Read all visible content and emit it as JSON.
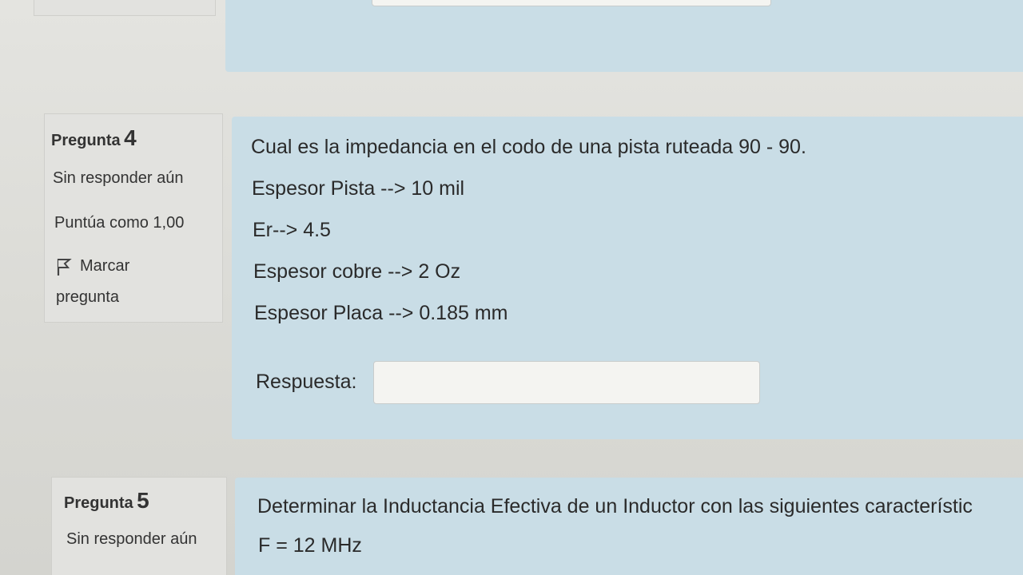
{
  "question4": {
    "label": "Pregunta",
    "number": "4",
    "state": "Sin responder aún",
    "grade": "Puntúa como 1,00",
    "flag_label_1": "Marcar",
    "flag_label_2": "pregunta",
    "flag_icon": "flag-icon",
    "lines": [
      "Cual es la impedancia en el codo de una pista ruteada 90 - 90.",
      "Espesor Pista --> 10 mil",
      "Er--> 4.5",
      "Espesor cobre --> 2 Oz",
      "Espesor Placa --> 0.185 mm"
    ],
    "answer_label": "Respuesta:",
    "answer_value": ""
  },
  "question5": {
    "label": "Pregunta",
    "number": "5",
    "state": "Sin responder aún",
    "lines": [
      "Determinar la Inductancia Efectiva de un Inductor con las siguientes característic",
      "F = 12 MHz"
    ]
  },
  "colors": {
    "content_bg": "#c9dde6",
    "info_bg": "#e2e2df"
  }
}
